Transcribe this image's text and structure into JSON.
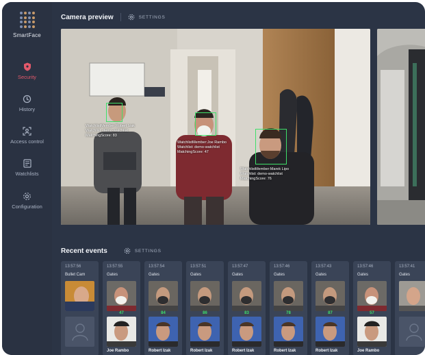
{
  "app": {
    "name": "SmartFace",
    "accent": "#e3596b",
    "match_color": "#3ee06a"
  },
  "sidebar": {
    "items": [
      {
        "label": "Security",
        "icon": "shield-icon",
        "active": true
      },
      {
        "label": "History",
        "icon": "history-icon",
        "active": false
      },
      {
        "label": "Access control",
        "icon": "access-control-icon",
        "active": false
      },
      {
        "label": "Watchlists",
        "icon": "watchlist-icon",
        "active": false
      },
      {
        "label": "Configuration",
        "icon": "gear-icon",
        "active": false
      }
    ]
  },
  "camera_preview": {
    "title": "Camera preview",
    "settings_label": "SETTINGS",
    "detections": [
      {
        "member_label": "WatchlistMember:",
        "member": "Robert Izak",
        "watchlist_label": "Watchlist:",
        "watchlist": "demo-watchlist",
        "score_label": "MatchingScore:",
        "score": "83"
      },
      {
        "member_label": "WatchlistMember:",
        "member": "Joe Rambo",
        "watchlist_label": "Watchlist:",
        "watchlist": "demo-watchlist",
        "score_label": "MatchingScore:",
        "score": "47"
      },
      {
        "member_label": "WatchlistMember:",
        "member": "Marek Lipo",
        "watchlist_label": "Watchlist:",
        "watchlist": "demo-watchlist",
        "score_label": "MatchingScore:",
        "score": "76"
      }
    ]
  },
  "recent_events": {
    "title": "Recent events",
    "settings_label": "SETTINGS",
    "events": [
      {
        "time": "13:57:56",
        "camera": "Bullet Cam",
        "score": "",
        "name": ""
      },
      {
        "time": "13:57:55",
        "camera": "Gates",
        "score": "47",
        "name": "Joe Rambo"
      },
      {
        "time": "13:57:54",
        "camera": "Gates",
        "score": "84",
        "name": "Robert Izak"
      },
      {
        "time": "13:57:51",
        "camera": "Gates",
        "score": "86",
        "name": "Robert Izak"
      },
      {
        "time": "13:57:47",
        "camera": "Gates",
        "score": "83",
        "name": "Robert Izak"
      },
      {
        "time": "13:57:46",
        "camera": "Gates",
        "score": "78",
        "name": "Robert Izak"
      },
      {
        "time": "13:57:43",
        "camera": "Gates",
        "score": "87",
        "name": "Robert Izak"
      },
      {
        "time": "13:57:46",
        "camera": "Gates",
        "score": "57",
        "name": "Joe Rambo"
      },
      {
        "time": "13:57:41",
        "camera": "Gates",
        "score": "",
        "name": ""
      }
    ]
  }
}
